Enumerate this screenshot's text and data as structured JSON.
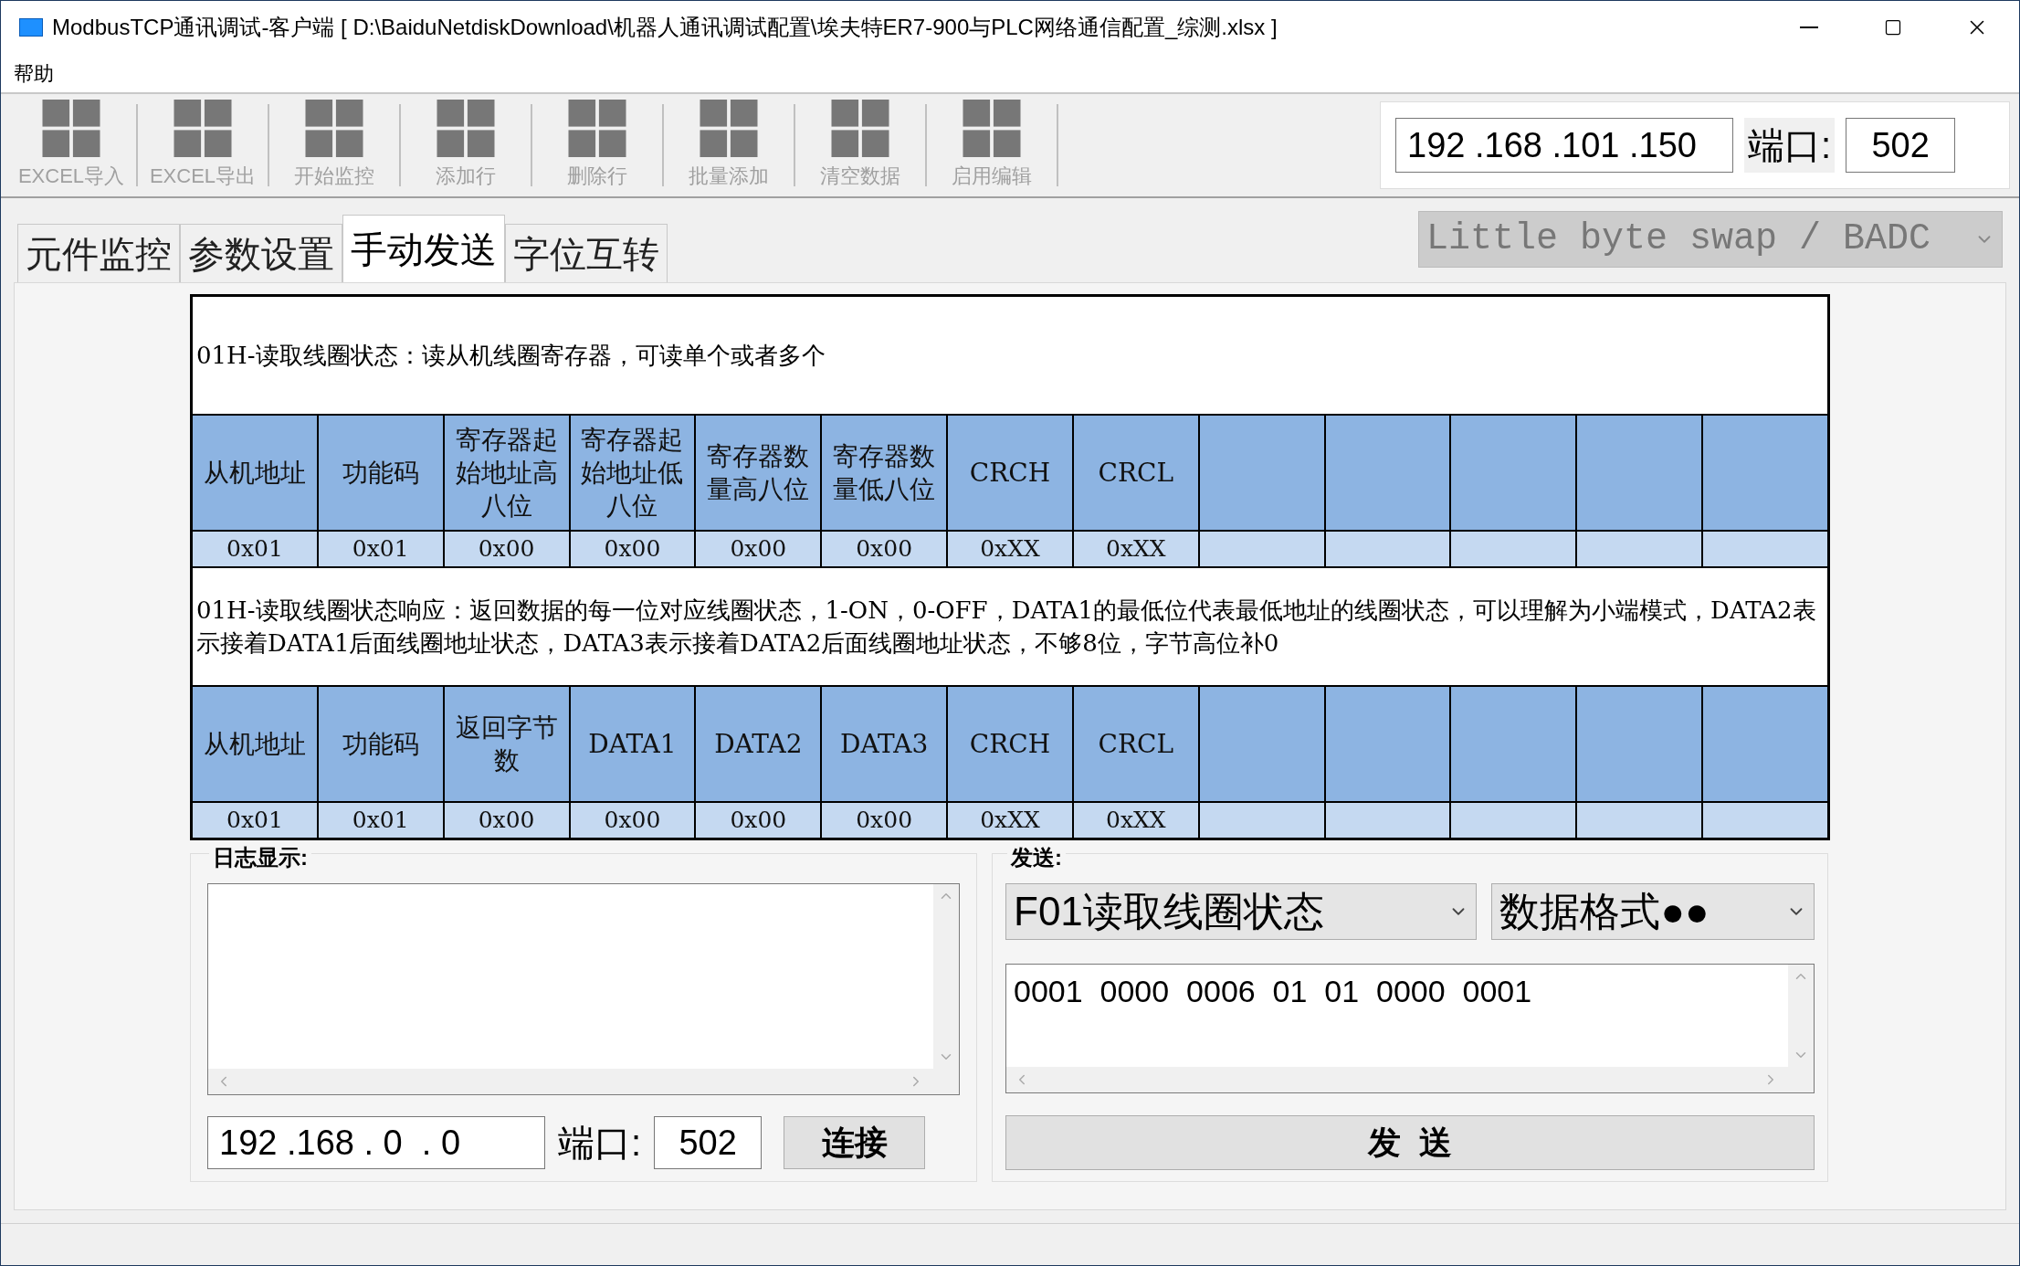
{
  "window": {
    "title": "ModbusTCP通讯调试-客户端  [ D:\\BaiduNetdiskDownload\\机器人通讯调试配置\\埃夫特ER7-900与PLC网络通信配置_综测.xlsx ]"
  },
  "menu": [
    "帮助"
  ],
  "toolbar": {
    "buttons": [
      {
        "label": "EXCEL导入",
        "disabled": true
      },
      {
        "label": "EXCEL导出",
        "disabled": true
      },
      {
        "label": "开始监控",
        "disabled": true
      },
      {
        "label": "添加行",
        "disabled": true
      },
      {
        "label": "删除行",
        "disabled": true
      },
      {
        "label": "批量添加",
        "disabled": true
      },
      {
        "label": "清空数据",
        "disabled": true
      },
      {
        "label": "启用编辑",
        "disabled": true
      }
    ],
    "ip": "192 .168 .101 .150",
    "port_label": "端口:",
    "port": "502"
  },
  "tabs": [
    {
      "label": "元件监控",
      "selected": false
    },
    {
      "label": "参数设置",
      "selected": false
    },
    {
      "label": "手动发送",
      "selected": true
    },
    {
      "label": "字位互转",
      "selected": false
    }
  ],
  "byte_order": {
    "value": "Little byte swap / BADC",
    "disabled": true
  },
  "frames": [
    {
      "caption": "01H-读取线圈状态：读从机线圈寄存器，可读单个或者多个",
      "headers": [
        "从机地址",
        "功能码",
        "寄存器起始地址高八位",
        "寄存器起始地址低八位",
        "寄存器数量高八位",
        "寄存器数量低八位",
        "CRCH",
        "CRCL"
      ],
      "values": [
        "0x01",
        "0x01",
        "0x00",
        "0x00",
        "0x00",
        "0x00",
        "0xXX",
        "0xXX"
      ]
    },
    {
      "caption": "01H-读取线圈状态响应：返回数据的每一位对应线圈状态，1-ON，0-OFF，DATA1的最低位代表最低地址的线圈状态，可以理解为小端模式，DATA2表示接着DATA1后面线圈地址状态，DATA3表示接着DATA2后面线圈地址状态，不够8位，字节高位补0",
      "headers": [
        "从机地址",
        "功能码",
        "返回字节数",
        "DATA1",
        "DATA2",
        "DATA3",
        "CRCH",
        "CRCL"
      ],
      "values": [
        "0x01",
        "0x01",
        "0x00",
        "0x00",
        "0x00",
        "0x00",
        "0xXX",
        "0xXX"
      ]
    }
  ],
  "log": {
    "title": "日志显示:",
    "ip": "192 .168 . 0  . 0",
    "port_label": "端口:",
    "port": "502",
    "connect_button": "连接"
  },
  "send": {
    "title": "发送:",
    "function": "F01读取线圈状态",
    "format": "数据格式●●",
    "message": "0001  0000  0006  01  01  0000  0001",
    "send_button": "发  送"
  }
}
